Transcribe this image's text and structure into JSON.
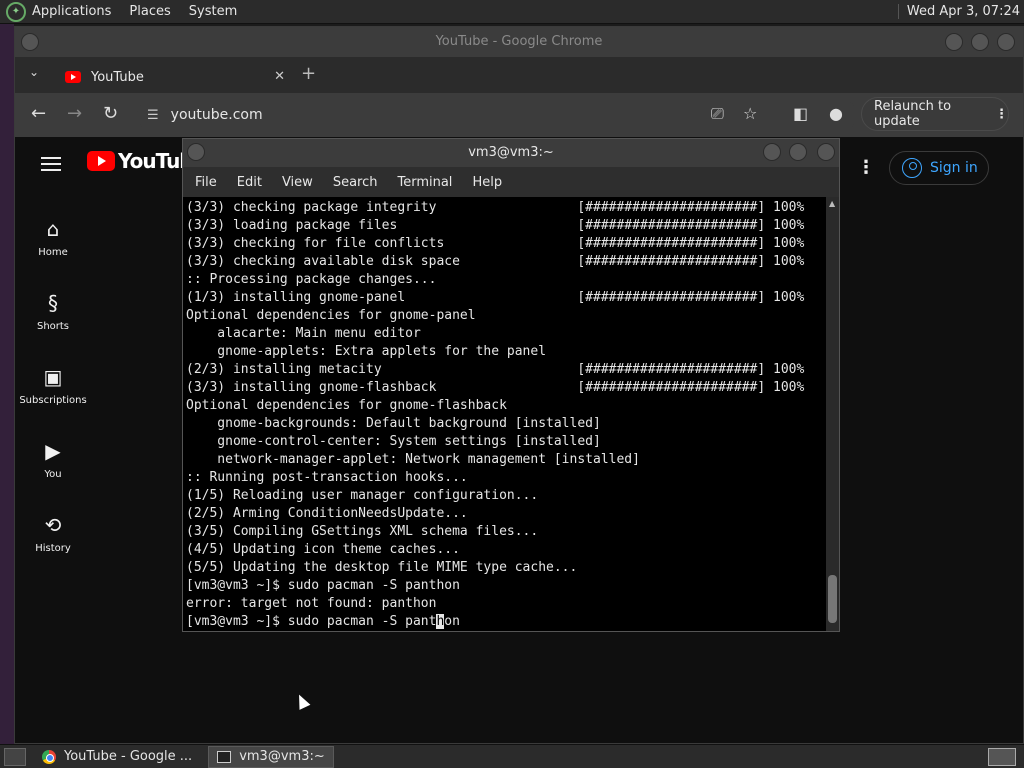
{
  "top_panel": {
    "menus": [
      "Applications",
      "Places",
      "System"
    ],
    "clock": "Wed Apr  3, 07:24"
  },
  "chrome": {
    "window_title": "YouTube - Google Chrome",
    "tab_title": "YouTube",
    "tab_close": "✕",
    "new_tab": "+",
    "url": "youtube.com",
    "relaunch_label": "Relaunch to update"
  },
  "youtube": {
    "logo_text": "YouTube",
    "nav": [
      {
        "label": "Home",
        "icon": "home-icon"
      },
      {
        "label": "Shorts",
        "icon": "shorts-icon"
      },
      {
        "label": "Subscriptions",
        "icon": "subscriptions-icon"
      },
      {
        "label": "You",
        "icon": "you-icon"
      },
      {
        "label": "History",
        "icon": "history-icon"
      }
    ],
    "sign_in": "Sign in"
  },
  "terminal": {
    "title": "vm3@vm3:~",
    "menus": [
      "File",
      "Edit",
      "View",
      "Search",
      "Terminal",
      "Help"
    ],
    "lines": [
      "(3/3) checking package integrity                  [######################] 100%",
      "(3/3) loading package files                       [######################] 100%",
      "(3/3) checking for file conflicts                 [######################] 100%",
      "(3/3) checking available disk space               [######################] 100%",
      ":: Processing package changes...",
      "(1/3) installing gnome-panel                      [######################] 100%",
      "Optional dependencies for gnome-panel",
      "    alacarte: Main menu editor",
      "    gnome-applets: Extra applets for the panel",
      "(2/3) installing metacity                         [######################] 100%",
      "(3/3) installing gnome-flashback                  [######################] 100%",
      "Optional dependencies for gnome-flashback",
      "    gnome-backgrounds: Default background [installed]",
      "    gnome-control-center: System settings [installed]",
      "    network-manager-applet: Network management [installed]",
      ":: Running post-transaction hooks...",
      "(1/5) Reloading user manager configuration...",
      "(2/5) Arming ConditionNeedsUpdate...",
      "(3/5) Compiling GSettings XML schema files...",
      "(4/5) Updating icon theme caches...",
      "(5/5) Updating the desktop file MIME type cache...",
      "[vm3@vm3 ~]$ sudo pacman -S panthon",
      "error: target not found: panthon"
    ],
    "prompt_before_cursor": "[vm3@vm3 ~]$ sudo pacman -S pant",
    "cursor_char": "h",
    "prompt_after_cursor": "on"
  },
  "taskbar": {
    "items": [
      {
        "label": "YouTube - Google ...",
        "active": false
      },
      {
        "label": "vm3@vm3:~",
        "active": true
      }
    ]
  }
}
